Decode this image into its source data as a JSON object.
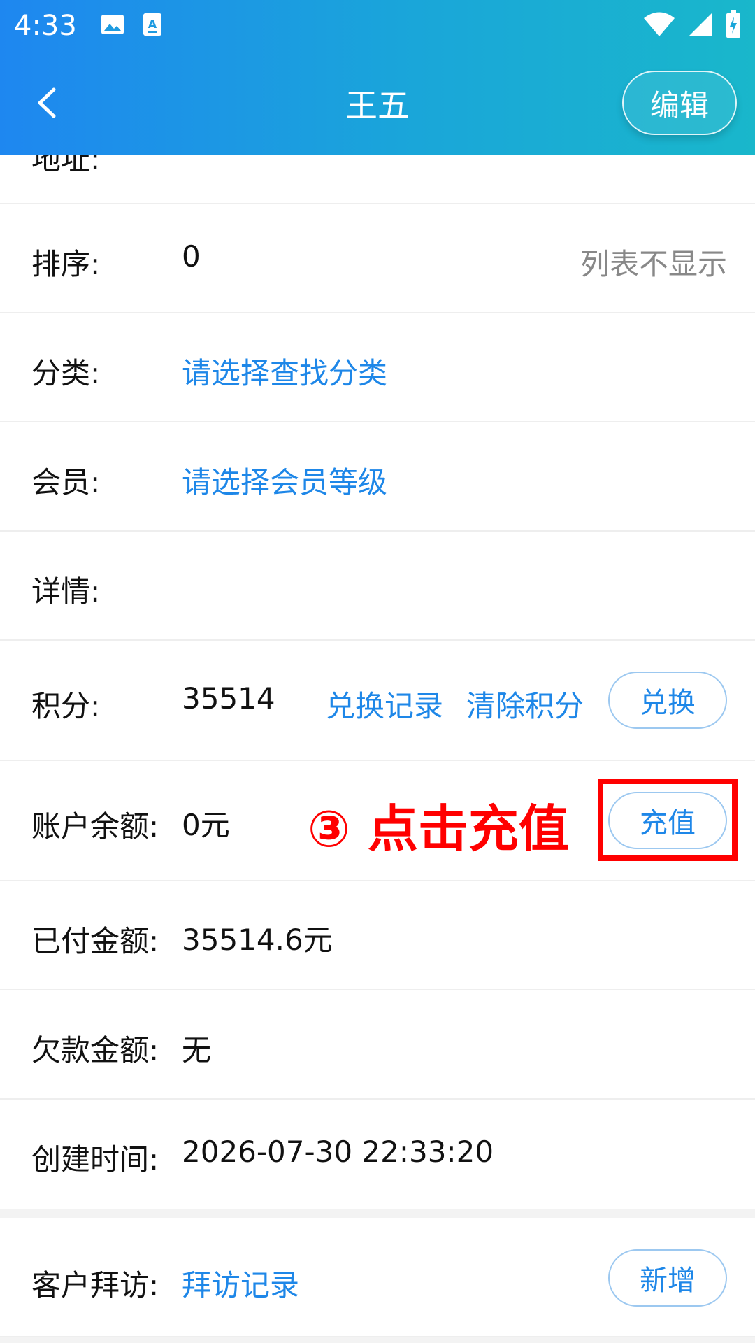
{
  "status_bar": {
    "time": "4:33",
    "left_icons": [
      "image-icon",
      "accessibility-icon"
    ],
    "right_icons": [
      "wifi-icon",
      "signal-icon",
      "battery-charging-icon"
    ]
  },
  "header": {
    "title": "王五",
    "edit_label": "编辑",
    "back_icon": "chevron-left-icon"
  },
  "rows": {
    "address": {
      "label": "地址:"
    },
    "sort": {
      "label": "排序:",
      "value": "0",
      "hint": "列表不显示"
    },
    "category": {
      "label": "分类:",
      "value": "请选择查找分类"
    },
    "member": {
      "label": "会员:",
      "value": "请选择会员等级"
    },
    "details": {
      "label": "详情:"
    },
    "points": {
      "label": "积分:",
      "value": "35514",
      "exchange_record": "兑换记录",
      "clear_points": "清除积分",
      "exchange_button": "兑换"
    },
    "balance": {
      "label": "账户余额:",
      "value": "0元",
      "recharge_button": "充值",
      "annotation": "③ 点击充值"
    },
    "paid": {
      "label": "已付金额:",
      "value": "35514.6元"
    },
    "debt": {
      "label": "欠款金额:",
      "value": "无"
    },
    "created": {
      "label": "创建时间:",
      "value": "2026-07-30 22:33:20"
    },
    "visit": {
      "label": "客户拜访:",
      "link": "拜访记录",
      "add_button": "新增"
    }
  },
  "colors": {
    "header_gradient_start": "#1E87F0",
    "header_gradient_end": "#19B7CB",
    "link": "#1E87E8",
    "annotation": "#FF0000",
    "hint": "#888888"
  }
}
